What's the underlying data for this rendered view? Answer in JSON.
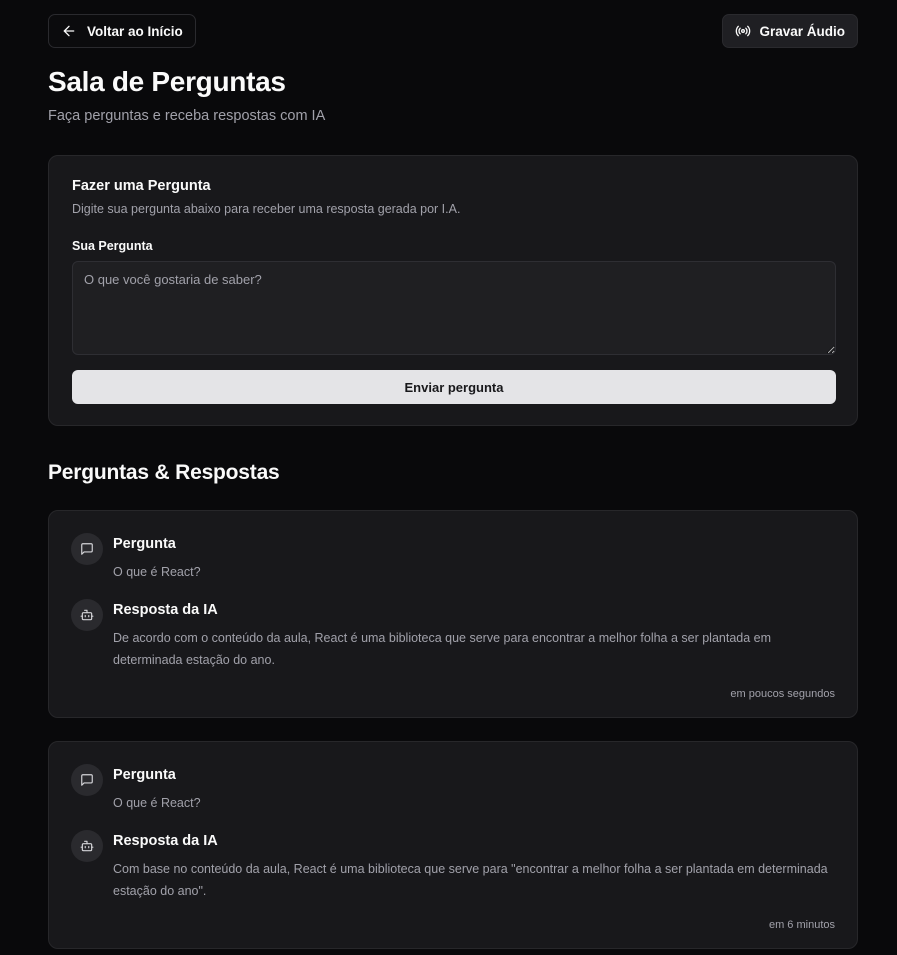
{
  "header": {
    "back_label": "Voltar ao Início",
    "record_label": "Gravar Áudio",
    "title": "Sala de Perguntas",
    "subtitle": "Faça perguntas e receba respostas com IA"
  },
  "form": {
    "title": "Fazer uma Pergunta",
    "description": "Digite sua pergunta abaixo para receber uma resposta gerada por I.A.",
    "field_label": "Sua Pergunta",
    "placeholder": "O que você gostaria de saber?",
    "value": "",
    "submit_label": "Enviar pergunta"
  },
  "qa_section": {
    "title": "Perguntas & Respostas",
    "items": [
      {
        "question_label": "Pergunta",
        "question": "O que é React?",
        "answer_label": "Resposta da IA",
        "answer": "De acordo com o conteúdo da aula, React é uma biblioteca que serve para encontrar a melhor folha a ser plantada em determinada estação do ano.",
        "time": "em poucos segundos"
      },
      {
        "question_label": "Pergunta",
        "question": "O que é React?",
        "answer_label": "Resposta da IA",
        "answer": "Com base no conteúdo da aula, React é uma biblioteca que serve para \"encontrar a melhor folha a ser plantada em determinada estação do ano\".",
        "time": "em 6 minutos"
      }
    ]
  },
  "icons": {
    "back": "arrow-left-icon",
    "record": "radio-icon",
    "question": "message-square-icon",
    "answer": "bot-icon"
  }
}
